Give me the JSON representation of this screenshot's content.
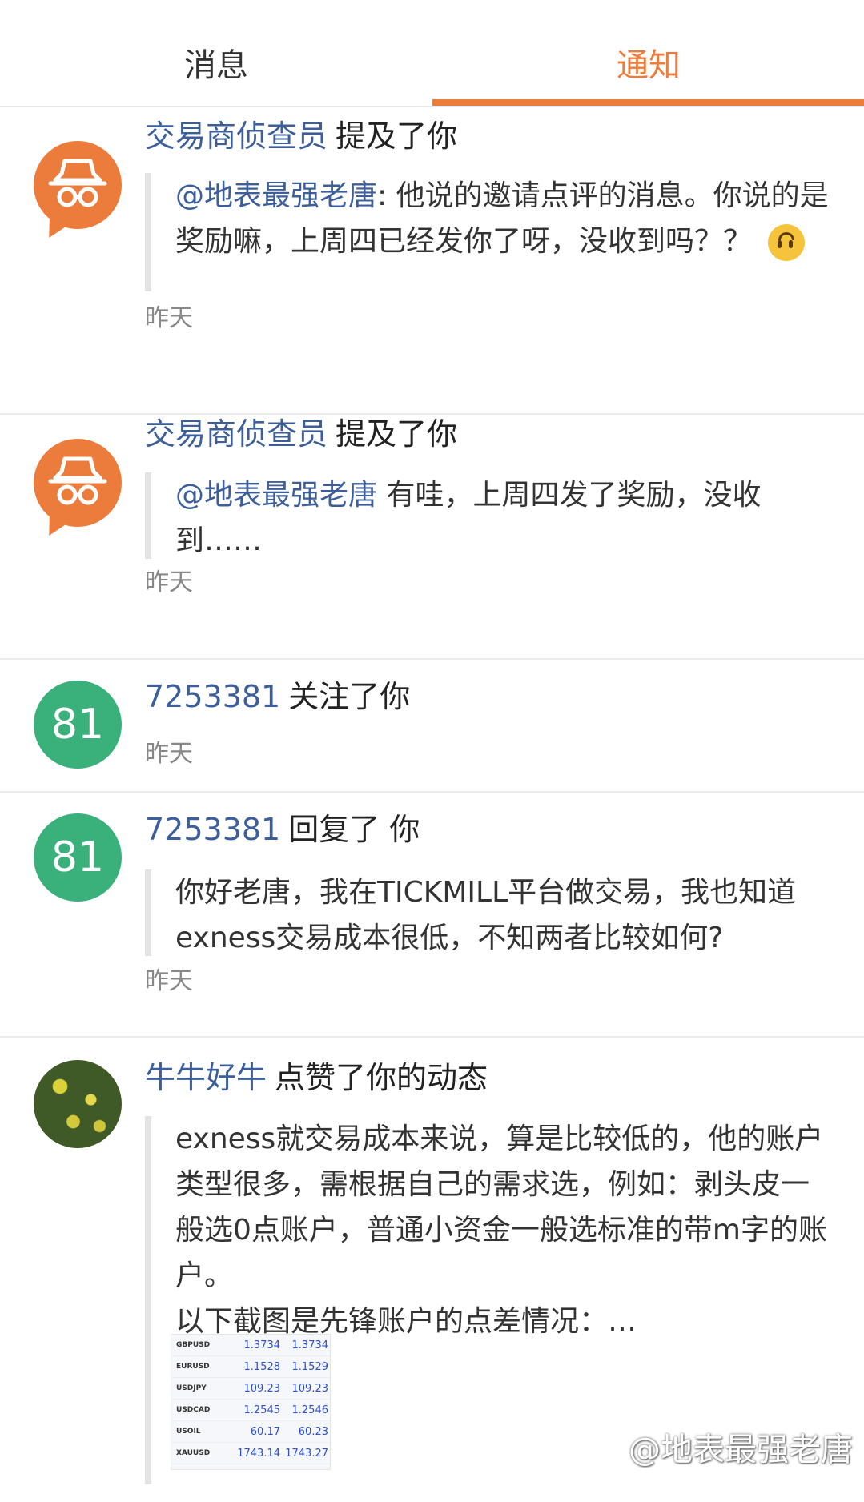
{
  "tabs": {
    "messages": "消息",
    "notifications": "通知"
  },
  "colors": {
    "accent": "#ec7c3c",
    "link": "#3c5f9b",
    "avatar_green": "#3ab07a"
  },
  "notifications": [
    {
      "user": "交易商侦查员",
      "action": "提及了你",
      "mention": "@地表最强老唐",
      "text_1": ": 他说的邀请点评的消息。你说的是奖励嘛，上周四已经发你了呀，没收到吗？？",
      "time": "昨天"
    },
    {
      "user": "交易商侦查员",
      "action": "提及了你",
      "mention": "@地表最强老唐",
      "text_1": " 有哇，上周四发了奖励，没收到……",
      "time": "昨天"
    },
    {
      "avatar_text": "81",
      "user": "7253381",
      "action": "关注了你",
      "time": "昨天"
    },
    {
      "avatar_text": "81",
      "user": "7253381",
      "action": "回复了 你",
      "text_1": "你好老唐，我在TICKMILL平台做交易，我也知道exness交易成本很低，不知两者比较如何?",
      "time": "昨天"
    },
    {
      "user": "牛牛好牛",
      "action": "点赞了你的动态",
      "text_1": "exness就交易成本来说，算是比较低的，他的账户类型很多，需根据自己的需求选，例如：剥头皮一般选0点账户，普通小资金一般选标准的带m字的账户。",
      "text_2": "以下截图是先锋账户的点差情况：…"
    }
  ],
  "thumbnail_rows": [
    {
      "sym": "GBPUSD",
      "bid": "1.3734",
      "ask": "1.3734"
    },
    {
      "sym": "EURUSD",
      "bid": "1.1528",
      "ask": "1.1529"
    },
    {
      "sym": "USDJPY",
      "bid": "109.23",
      "ask": "109.23"
    },
    {
      "sym": "USDCAD",
      "bid": "1.2545",
      "ask": "1.2546"
    },
    {
      "sym": "USOIL",
      "bid": "60.17",
      "ask": "60.23"
    },
    {
      "sym": "XAUUSD",
      "bid": "1743.14",
      "ask": "1743.27"
    }
  ],
  "watermark": "@地表最强老唐"
}
